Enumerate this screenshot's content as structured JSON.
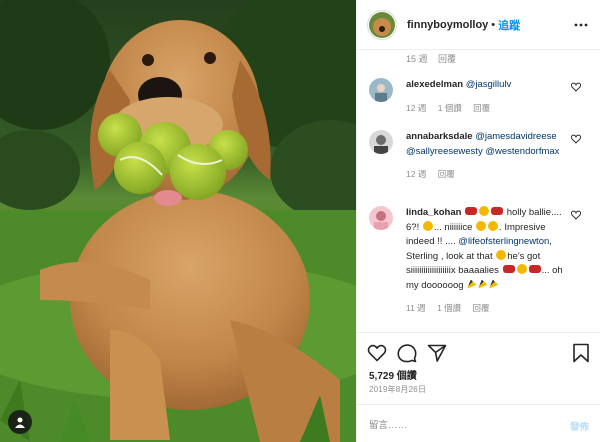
{
  "colors": {
    "accent": "#0095f6",
    "text": "#262626",
    "muted": "#8e8e8e",
    "mention": "#00376b",
    "border": "#efefef"
  },
  "header": {
    "username": "finnyboymolloy",
    "separator": "•",
    "follow_label": "追蹤",
    "more_icon": "more-horizontal-icon"
  },
  "top_meta": {
    "time": "15 週",
    "reply": "回覆"
  },
  "comments": [
    {
      "username": "alexedelman",
      "text_parts": [
        "@jasgillulv"
      ],
      "time": "12 週",
      "likes": "1 個讚",
      "reply": "回覆"
    },
    {
      "username": "annabarksdale",
      "mentions": [
        "@jamesdavidreese",
        "@sallyreesewesty",
        "@westendorfmax"
      ],
      "time": "12 週",
      "reply": "回覆"
    },
    {
      "username": "linda_kohan",
      "t1": "holly ballie.... 6?!",
      "t2": "... niiiiiice",
      "t3": ". Impresive indeed !! ....",
      "mention": "@lifeofsterlingnewton",
      "t4": ", Sterling , look at that",
      "t5": "he's got siiiiiiiiiiiiiiiiiiix baaaalies",
      "t6": "... oh my doooooog",
      "time": "11 週",
      "likes": "1 個讚",
      "reply": "回覆"
    }
  ],
  "actions": {
    "like_icon": "heart-icon",
    "comment_icon": "comment-icon",
    "share_icon": "share-icon",
    "save_icon": "bookmark-icon"
  },
  "likes": "5,729 個讚",
  "date": "2019年8月26日",
  "comment_box": {
    "placeholder": "留言……",
    "post_label": "發佈"
  }
}
